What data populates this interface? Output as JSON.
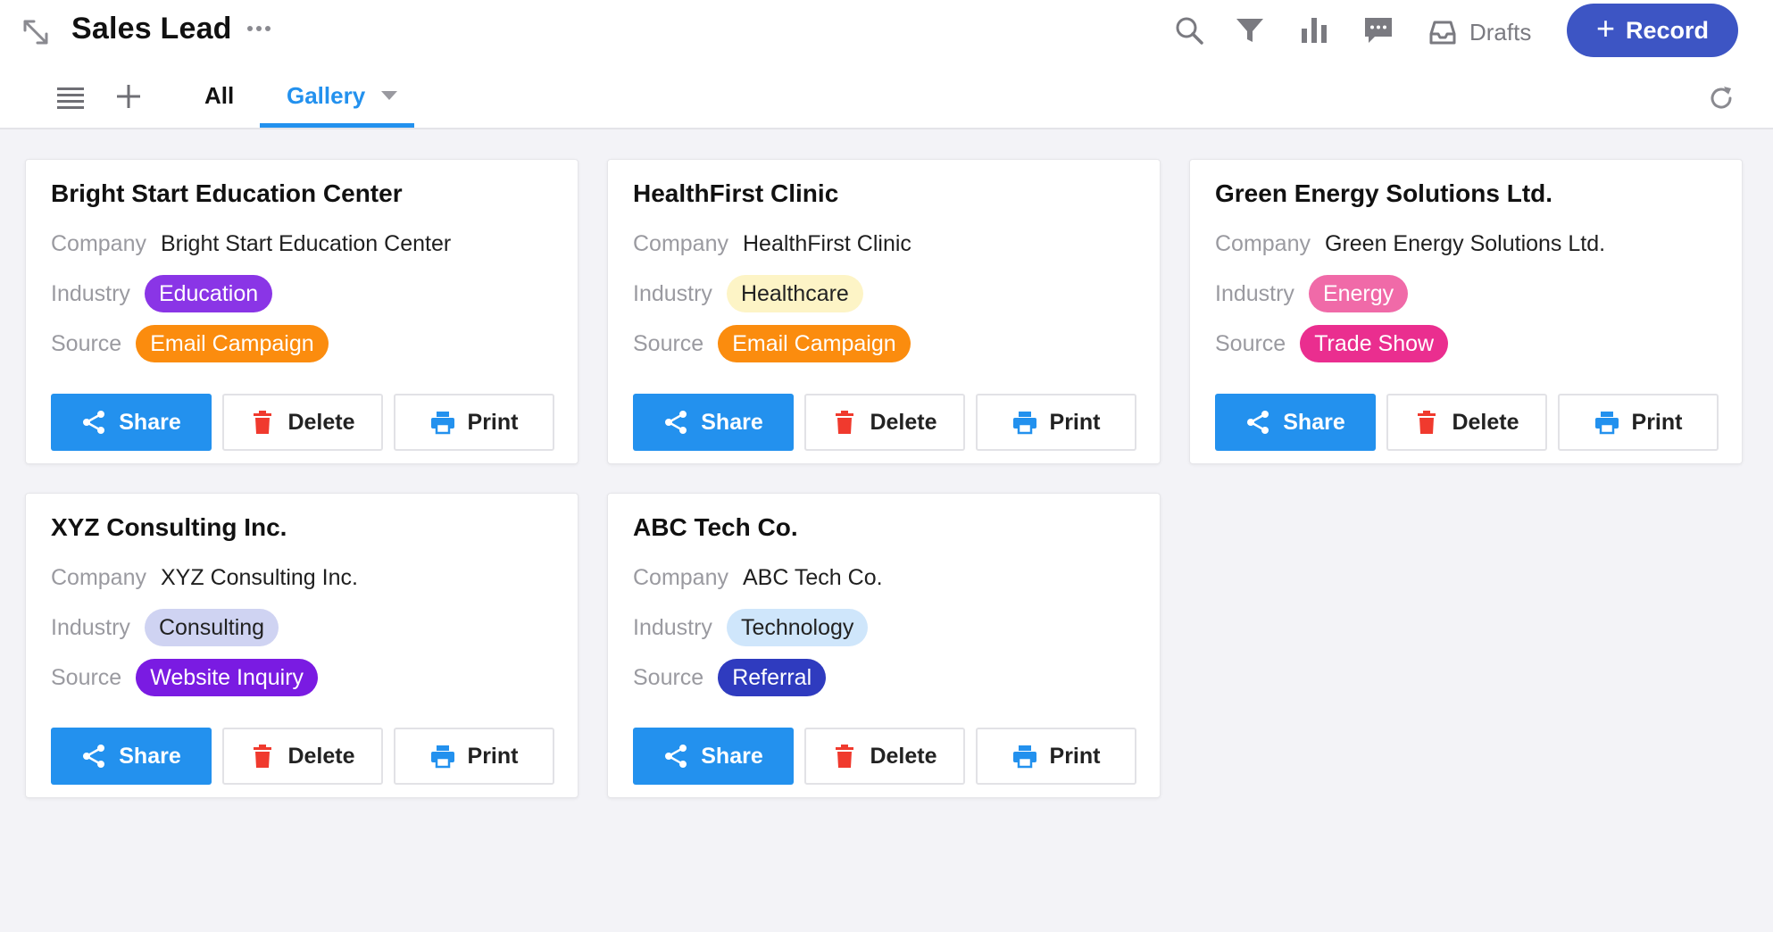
{
  "header": {
    "title": "Sales Lead",
    "drafts_label": "Drafts",
    "record_label": "Record"
  },
  "tabs": {
    "all": "All",
    "gallery": "Gallery",
    "active": "Gallery"
  },
  "labels": {
    "company": "Company",
    "industry": "Industry",
    "source": "Source",
    "share": "Share",
    "delete": "Delete",
    "print": "Print"
  },
  "cards": [
    {
      "title": "Bright Start Education Center",
      "company": "Bright Start Education Center",
      "industry": {
        "text": "Education",
        "bg": "#8a35e6",
        "fg": "#ffffff"
      },
      "source": {
        "text": "Email Campaign",
        "bg": "#fb8c0e",
        "fg": "#ffffff"
      }
    },
    {
      "title": "HealthFirst Clinic",
      "company": "HealthFirst Clinic",
      "industry": {
        "text": "Healthcare",
        "bg": "#fdf4c6",
        "fg": "#222222"
      },
      "source": {
        "text": "Email Campaign",
        "bg": "#fb8c0e",
        "fg": "#ffffff"
      }
    },
    {
      "title": "Green Energy Solutions Ltd.",
      "company": "Green Energy Solutions Ltd.",
      "industry": {
        "text": "Energy",
        "bg": "#f06aa8",
        "fg": "#ffffff"
      },
      "source": {
        "text": "Trade Show",
        "bg": "#ea2e8f",
        "fg": "#ffffff"
      }
    },
    {
      "title": "XYZ Consulting Inc.",
      "company": "XYZ Consulting Inc.",
      "industry": {
        "text": "Consulting",
        "bg": "#cfd3f2",
        "fg": "#222222"
      },
      "source": {
        "text": "Website Inquiry",
        "bg": "#7a1be2",
        "fg": "#ffffff"
      }
    },
    {
      "title": "ABC Tech Co.",
      "company": "ABC Tech Co.",
      "industry": {
        "text": "Technology",
        "bg": "#cfe6fb",
        "fg": "#222222"
      },
      "source": {
        "text": "Referral",
        "bg": "#2f3bbf",
        "fg": "#ffffff"
      }
    }
  ],
  "colors": {
    "accent": "#2391ee",
    "record_button": "#3d55c4",
    "delete_icon": "#f03a2e",
    "print_icon": "#2391ee"
  },
  "icons": {
    "expand": "expand-diagonal-icon",
    "more": "more-dots-icon",
    "search": "search-icon",
    "filter": "filter-icon",
    "chart": "bar-chart-icon",
    "comment": "comment-icon",
    "drafts": "inbox-icon",
    "list": "list-icon",
    "add": "plus-icon",
    "refresh": "refresh-icon",
    "share": "share-icon",
    "delete": "trash-icon",
    "print": "printer-icon"
  }
}
